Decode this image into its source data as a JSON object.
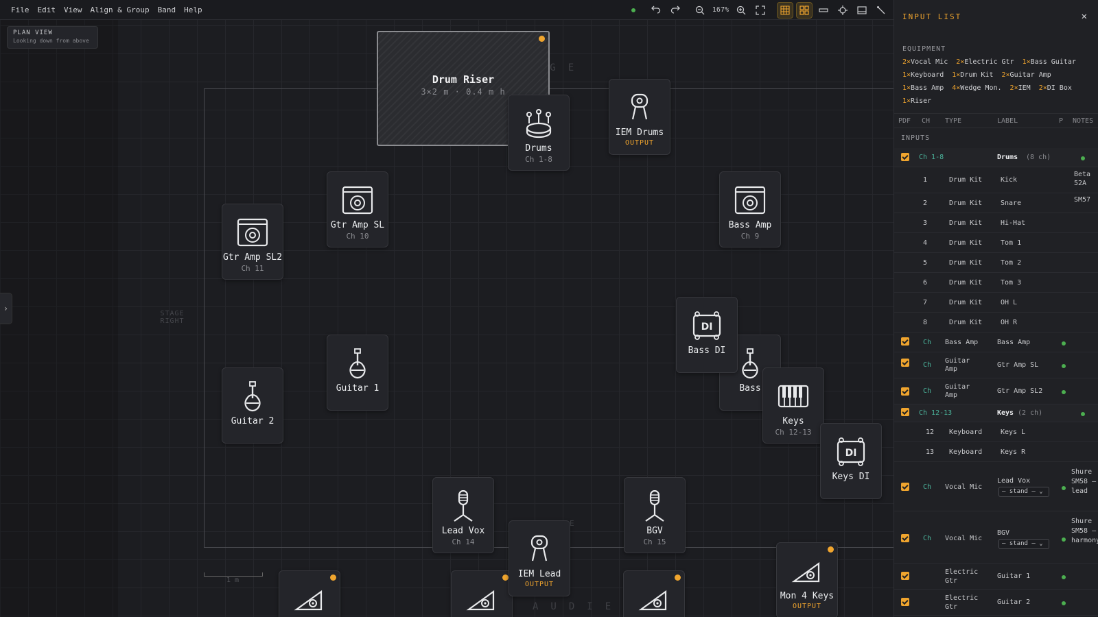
{
  "menubar": {
    "items": [
      "File",
      "Edit",
      "View",
      "Align & Group",
      "Band",
      "Help"
    ],
    "zoom": "167%"
  },
  "canvas": {
    "plan_view_title": "PLAN VIEW",
    "plan_view_subtitle": "Looking down from above",
    "stage_label_top": "STAGE",
    "stage_label_bottom": "AUDIENCE",
    "stage_right": "STAGE RIGHT",
    "stage_fragment_e": "E",
    "scale_label": "1 m",
    "riser": {
      "title": "Drum Riser",
      "dims": "3×2 m · 0.4 m h"
    },
    "nodes": [
      {
        "name": "Drums",
        "sub": "Ch 1-8",
        "icon": "drum-kit-icon"
      },
      {
        "name": "IEM Drums",
        "sub": "OUTPUT",
        "icon": "iem-icon"
      },
      {
        "name": "Gtr Amp SL",
        "sub": "Ch 10",
        "icon": "amp-icon"
      },
      {
        "name": "Gtr Amp SL2",
        "sub": "Ch 11",
        "icon": "amp-icon"
      },
      {
        "name": "Bass Amp",
        "sub": "Ch 9",
        "icon": "amp-icon"
      },
      {
        "name": "Bass DI",
        "sub": "",
        "icon": "di-box-icon"
      },
      {
        "name": "Bass",
        "sub": "",
        "icon": "guitar-icon"
      },
      {
        "name": "Guitar 1",
        "sub": "",
        "icon": "guitar-icon"
      },
      {
        "name": "Guitar 2",
        "sub": "",
        "icon": "guitar-icon"
      },
      {
        "name": "Keys",
        "sub": "Ch 12-13",
        "icon": "keyboard-icon"
      },
      {
        "name": "Keys DI",
        "sub": "",
        "icon": "di-box-icon"
      },
      {
        "name": "Lead Vox",
        "sub": "Ch 14",
        "icon": "vocal-mic-icon"
      },
      {
        "name": "BGV",
        "sub": "Ch 15",
        "icon": "vocal-mic-icon"
      },
      {
        "name": "IEM Lead",
        "sub": "OUTPUT",
        "icon": "iem-icon"
      },
      {
        "name": "Mon 4 Keys",
        "sub": "OUTPUT",
        "icon": "wedge-monitor-icon"
      }
    ]
  },
  "panel": {
    "title": "INPUT LIST",
    "equipment_title": "EQUIPMENT",
    "equipment": [
      {
        "n": "2×",
        "label": "Vocal Mic"
      },
      {
        "n": "2×",
        "label": "Electric Gtr"
      },
      {
        "n": "1×",
        "label": "Bass Guitar"
      },
      {
        "n": "1×",
        "label": "Keyboard"
      },
      {
        "n": "1×",
        "label": "Drum Kit"
      },
      {
        "n": "2×",
        "label": "Guitar Amp"
      },
      {
        "n": "1×",
        "label": "Bass Amp"
      },
      {
        "n": "4×",
        "label": "Wedge Mon."
      },
      {
        "n": "2×",
        "label": "IEM"
      },
      {
        "n": "2×",
        "label": "DI Box"
      },
      {
        "n": "1×",
        "label": "Riser"
      }
    ],
    "columns": [
      "PDF",
      "CH",
      "TYPE",
      "LABEL",
      "P",
      "NOTES"
    ],
    "inputs_title": "INPUTS",
    "drums_group": {
      "ch": "Ch 1-8",
      "label": "Drums",
      "count": "(8 ch)"
    },
    "drum_rows": [
      {
        "ch": "1",
        "type": "Drum Kit",
        "label": "Kick",
        "notes": "Beta 52A"
      },
      {
        "ch": "2",
        "type": "Drum Kit",
        "label": "Snare",
        "notes": "SM57"
      },
      {
        "ch": "3",
        "type": "Drum Kit",
        "label": "Hi-Hat",
        "notes": ""
      },
      {
        "ch": "4",
        "type": "Drum Kit",
        "label": "Tom 1",
        "notes": ""
      },
      {
        "ch": "5",
        "type": "Drum Kit",
        "label": "Tom 2",
        "notes": ""
      },
      {
        "ch": "6",
        "type": "Drum Kit",
        "label": "Tom 3",
        "notes": ""
      },
      {
        "ch": "7",
        "type": "Drum Kit",
        "label": "OH L",
        "notes": ""
      },
      {
        "ch": "8",
        "type": "Drum Kit",
        "label": "OH R",
        "notes": ""
      }
    ],
    "row_bass_amp": {
      "ch": "Ch",
      "type": "Bass Amp",
      "label": "Bass Amp"
    },
    "row_gtr_sl": {
      "ch": "Ch",
      "type": "Guitar Amp",
      "label": "Gtr Amp SL"
    },
    "row_gtr_sl2": {
      "ch": "Ch",
      "type": "Guitar Amp",
      "label": "Gtr Amp SL2"
    },
    "keys_group": {
      "ch": "Ch 12-13",
      "label": "Keys",
      "count": "(2 ch)"
    },
    "keys_rows": [
      {
        "ch": "12",
        "type": "Keyboard",
        "label": "Keys L"
      },
      {
        "ch": "13",
        "type": "Keyboard",
        "label": "Keys R"
      }
    ],
    "row_lead_vox": {
      "ch": "Ch",
      "type": "Vocal Mic",
      "label": "Lead Vox",
      "stand": "— stand —",
      "notes": "Shure SM58 — lead"
    },
    "row_bgv": {
      "ch": "Ch",
      "type": "Vocal Mic",
      "label": "BGV",
      "stand": "— stand —",
      "notes": "Shure SM58 — harmony"
    },
    "row_guitar1": {
      "type": "Electric Gtr",
      "label": "Guitar 1"
    },
    "row_guitar2": {
      "type": "Electric Gtr",
      "label": "Guitar 2"
    }
  }
}
